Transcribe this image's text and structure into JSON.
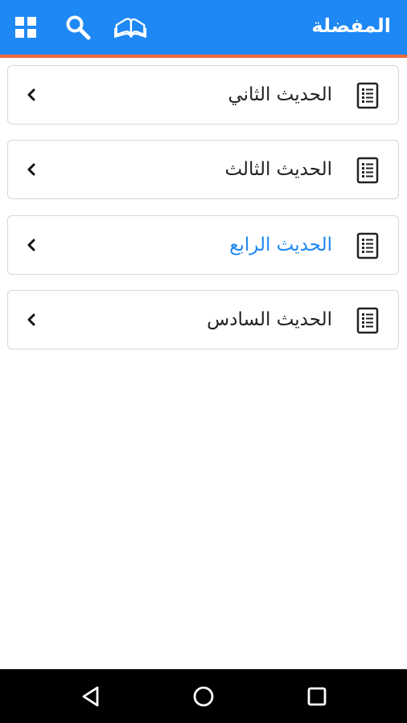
{
  "appbar": {
    "title": "المفضلة",
    "icons": [
      "grid-icon",
      "search-icon",
      "open-book-icon"
    ],
    "background": "#1e88f5",
    "accent_line": "#f26a3d"
  },
  "list": {
    "items": [
      {
        "label": "الحديث الثاني",
        "active": false
      },
      {
        "label": "الحديث الثالث",
        "active": false
      },
      {
        "label": "الحديث الرابع",
        "active": true
      },
      {
        "label": "الحديث السادس",
        "active": false
      }
    ],
    "active_color": "#1e88f5"
  },
  "navbar": {
    "buttons": [
      "back-triangle-icon",
      "home-circle-icon",
      "recents-square-icon"
    ]
  }
}
